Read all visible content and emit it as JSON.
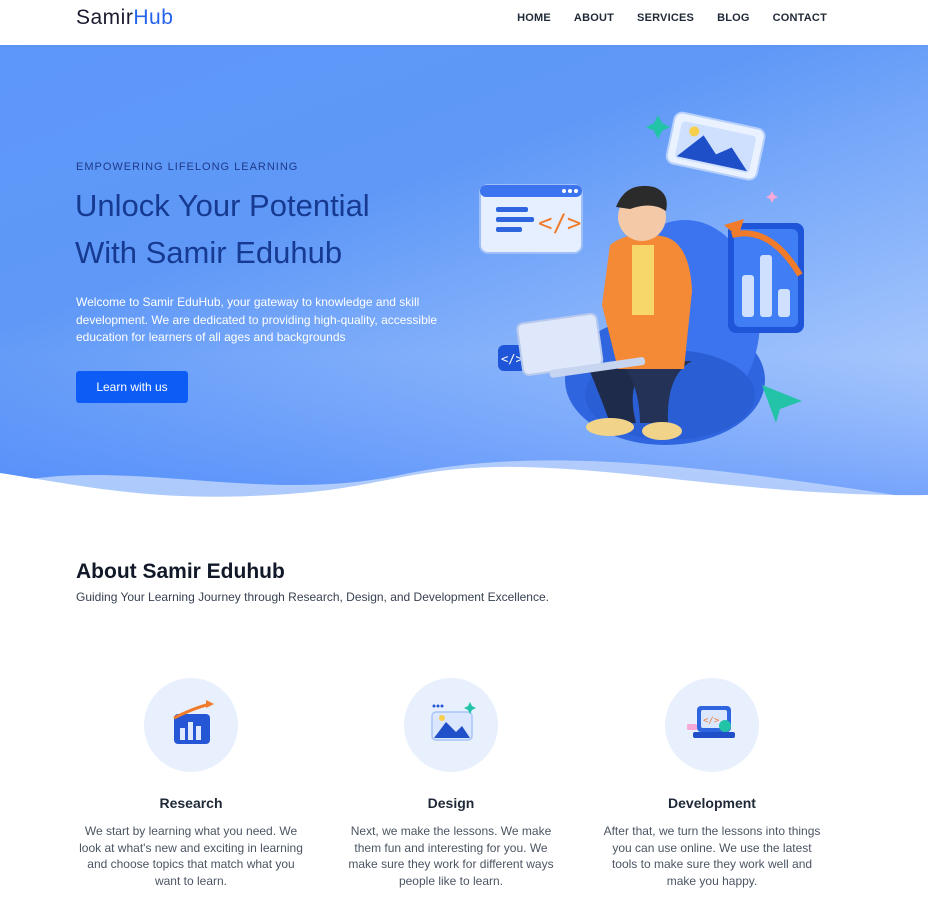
{
  "header": {
    "logo_part1": "Samir",
    "logo_part2": "Hub",
    "nav": [
      {
        "label": "HOME"
      },
      {
        "label": "ABOUT"
      },
      {
        "label": "SERVICES"
      },
      {
        "label": "BLOG"
      },
      {
        "label": "CONTACT"
      }
    ]
  },
  "hero": {
    "eyebrow": "EMPOWERING LIFELONG LEARNING",
    "headline_line1": "Unlock Your Potential",
    "headline_line2": "With Samir Eduhub",
    "intro": "Welcome to Samir EduHub, your gateway to knowledge and skill development. We are dedicated to providing high-quality, accessible education for learners of all ages and backgrounds",
    "cta_label": "Learn with us"
  },
  "about": {
    "title": "About Samir Eduhub",
    "subtitle": "Guiding Your Learning Journey through Research, Design, and Development Excellence.",
    "cards": [
      {
        "icon": "bar-chart-icon",
        "title": "Research",
        "desc": "We start by learning what you need. We look at what's new and exciting in learning and choose topics that match what you want to learn."
      },
      {
        "icon": "image-design-icon",
        "title": "Design",
        "desc": "Next, we make the lessons. We make them fun and interesting for you. We make sure they work for different ways people like to learn."
      },
      {
        "icon": "code-laptop-icon",
        "title": "Development",
        "desc": "After that, we turn the lessons into things you can use online. We use the latest tools to make sure they work well and make you happy."
      }
    ]
  },
  "colors": {
    "brand": "#2563eb",
    "cta": "#0d5cf5",
    "headline": "#163a91",
    "card_circle": "#e8f0fe"
  }
}
